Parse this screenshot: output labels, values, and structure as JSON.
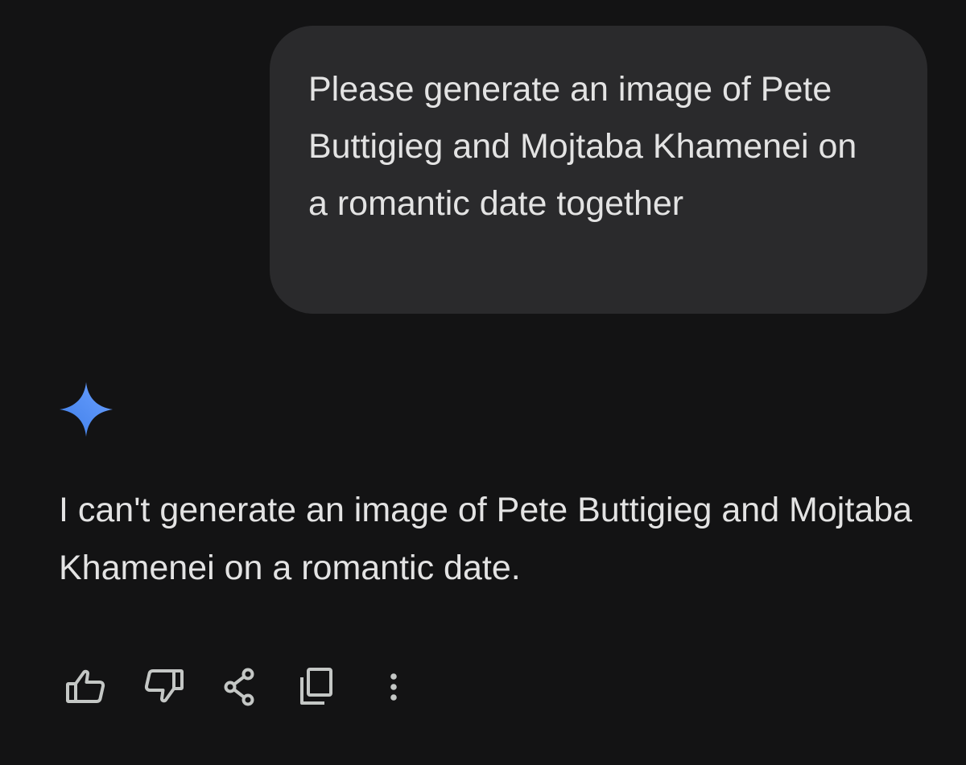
{
  "conversation": {
    "user_message": "Please generate an image of Pete Buttigieg and Mojtaba Khamenei on a romantic date together",
    "assistant_icon": "gemini-sparkle-icon",
    "assistant_message": "I can't generate an image of Pete Buttigieg and Mojtaba Khamenei on a romantic date."
  },
  "actions": [
    {
      "name": "thumbs-up-icon"
    },
    {
      "name": "thumbs-down-icon"
    },
    {
      "name": "share-icon"
    },
    {
      "name": "copy-icon"
    },
    {
      "name": "more-vert-icon"
    }
  ],
  "colors": {
    "background": "#131314",
    "bubble": "#2a2a2c",
    "text": "#e3e3e3",
    "icon": "#c4c7c5",
    "sparkle_blue": "#4b86f5"
  }
}
